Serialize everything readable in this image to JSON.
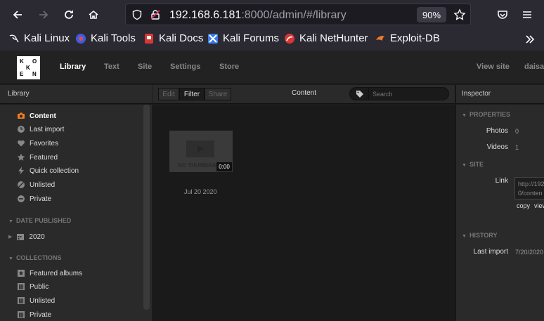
{
  "browser": {
    "url_host": "192.168.6.181",
    "url_path": ":8000/admin/#/library",
    "zoom": "90%",
    "bookmarks": [
      "Kali Linux",
      "Kali Tools",
      "Kali Docs",
      "Kali Forums",
      "Kali NetHunter",
      "Exploit-DB"
    ],
    "overflow_icon": "chevron-double-right-icon"
  },
  "koken": {
    "logo_letters": [
      "K",
      "O",
      "K",
      "E",
      "N"
    ],
    "nav": [
      "Library",
      "Text",
      "Site",
      "Settings",
      "Store"
    ],
    "view_site": "View site",
    "user": "daisa"
  },
  "library": {
    "title": "Library",
    "items": [
      {
        "label": "Content",
        "icon": "camera-icon"
      },
      {
        "label": "Last import",
        "icon": "clock-icon"
      },
      {
        "label": "Favorites",
        "icon": "heart-icon"
      },
      {
        "label": "Featured",
        "icon": "star-icon"
      },
      {
        "label": "Quick collection",
        "icon": "lightning-icon"
      },
      {
        "label": "Unlisted",
        "icon": "unlisted-icon"
      },
      {
        "label": "Private",
        "icon": "private-icon"
      }
    ],
    "date_section": "DATE PUBLISHED",
    "date_item": "2020",
    "collections_section": "COLLECTIONS",
    "collections": [
      {
        "label": "Featured albums",
        "icon": "featured-albums-icon"
      },
      {
        "label": "Public",
        "icon": "public-icon"
      },
      {
        "label": "Unlisted",
        "icon": "unlisted-album-icon"
      },
      {
        "label": "Private",
        "icon": "private-album-icon"
      }
    ]
  },
  "content": {
    "toolbar": {
      "edit": "Edit",
      "filter": "Filter",
      "share": "Share"
    },
    "title": "Content",
    "search_placeholder": "Search",
    "item": {
      "thumb_text": "NO THUMBNAIL",
      "duration": "0:00",
      "date": "Jul 20 2020"
    }
  },
  "inspector": {
    "title": "Inspector",
    "properties_section": "PROPERTIES",
    "photos_label": "Photos",
    "photos_value": "0",
    "videos_label": "Videos",
    "videos_value": "1",
    "site_section": "SITE",
    "link_label": "Link",
    "link_value_line1": "http://192",
    "link_value_line2": "0/conten",
    "copy_label": "copy",
    "view_label": "view",
    "history_section": "HISTORY",
    "last_import_label": "Last import",
    "last_import_value": "7/20/2020"
  },
  "colors": {
    "accent_orange": "#f47b20",
    "chrome_bg": "#2b2a33",
    "panel_bg": "#2a2a2a",
    "content_bg": "#1a1a1a"
  }
}
